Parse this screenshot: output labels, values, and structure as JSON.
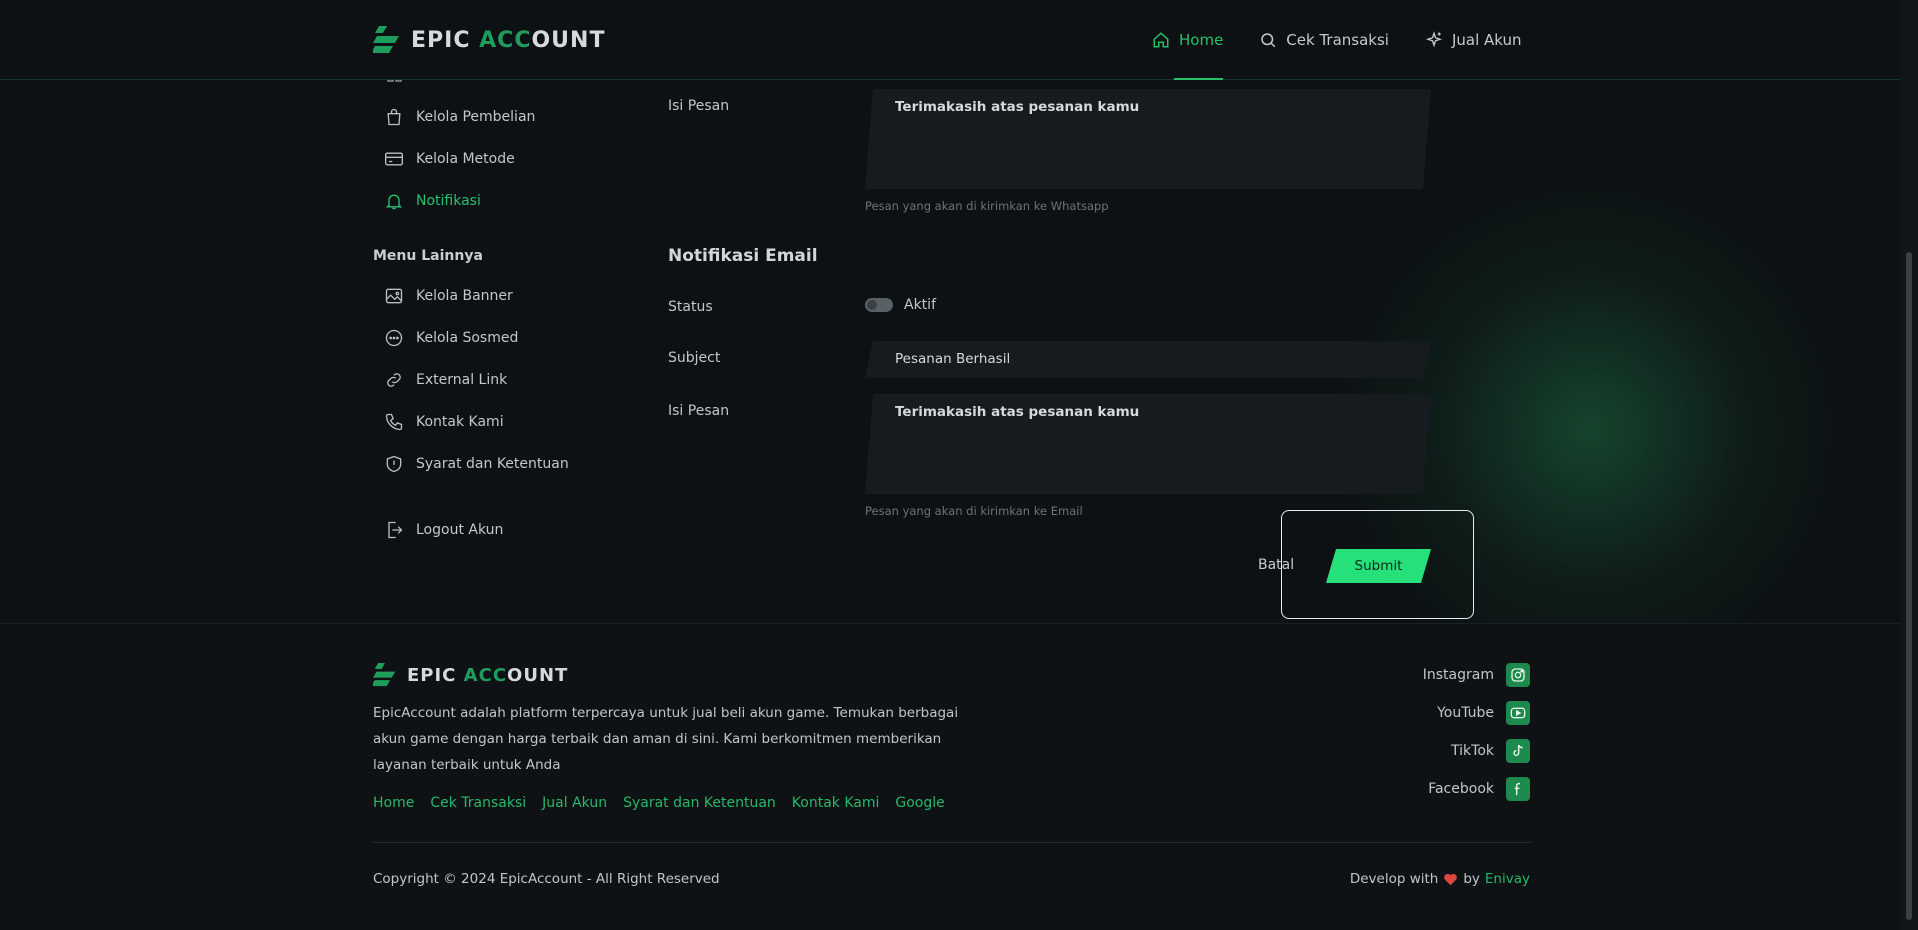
{
  "brand": {
    "part1": "EPIC ",
    "part2": "ACC",
    "part3": "OUNT"
  },
  "nav": [
    {
      "label": "Home",
      "icon": "home-icon",
      "active": true
    },
    {
      "label": "Cek Transaksi",
      "icon": "search-icon"
    },
    {
      "label": "Jual Akun",
      "icon": "sparkle-icon"
    }
  ],
  "sidebar": {
    "items": [
      {
        "label": "Kelola Pembelian",
        "icon": "shopping-bag-icon"
      },
      {
        "label": "Kelola Metode",
        "icon": "credit-card-icon"
      },
      {
        "label": "Notifikasi",
        "icon": "bell-icon",
        "active": true
      }
    ],
    "other_heading": "Menu Lainnya",
    "other_items": [
      {
        "label": "Kelola Banner",
        "icon": "image-icon"
      },
      {
        "label": "Kelola Sosmed",
        "icon": "chat-icon"
      },
      {
        "label": "External Link",
        "icon": "link-icon"
      },
      {
        "label": "Kontak Kami",
        "icon": "phone-icon"
      },
      {
        "label": "Syarat dan Ketentuan",
        "icon": "shield-icon"
      }
    ],
    "logout": {
      "label": "Logout Akun",
      "icon": "logout-icon"
    }
  },
  "whatsapp": {
    "message_label": "Isi Pesan",
    "message_value": "Terimakasih atas pesanan kamu",
    "message_hint": "Pesan yang akan di kirimkan ke Whatsapp"
  },
  "email": {
    "title": "Notifikasi Email",
    "status_label": "Status",
    "status_value": "Aktif",
    "subject_label": "Subject",
    "subject_value": "Pesanan Berhasil",
    "message_label": "Isi Pesan",
    "message_value": "Terimakasih atas pesanan kamu",
    "message_hint": "Pesan yang akan di kirimkan ke Email"
  },
  "actions": {
    "cancel": "Batal",
    "submit": "Submit"
  },
  "footer": {
    "description": "EpicAccount adalah platform terpercaya untuk jual beli akun game. Temukan berbagai akun game dengan harga terbaik dan aman di sini. Kami berkomitmen memberikan layanan terbaik untuk Anda",
    "links": [
      "Home",
      "Cek Transaksi",
      "Jual Akun",
      "Syarat dan Ketentuan",
      "Kontak Kami",
      "Google"
    ],
    "social": [
      {
        "label": "Instagram",
        "icon": "instagram-icon"
      },
      {
        "label": "YouTube",
        "icon": "youtube-icon"
      },
      {
        "label": "TikTok",
        "icon": "tiktok-icon"
      },
      {
        "label": "Facebook",
        "icon": "facebook-icon"
      }
    ],
    "copyright": "Copyright © 2024 EpicAccount - All Right Reserved",
    "develop_prefix": "Develop with",
    "develop_by": "by",
    "developer": "Enivay"
  },
  "colors": {
    "accent": "#26c06b",
    "button": "#26e07a",
    "background": "#0d1113"
  }
}
